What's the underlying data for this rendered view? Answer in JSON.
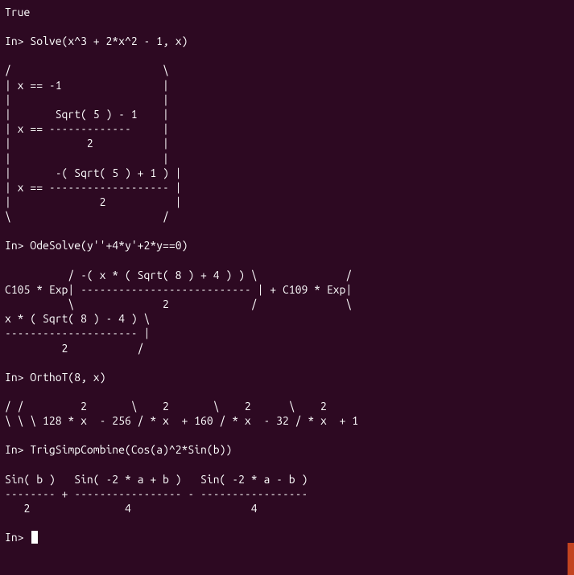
{
  "prev_result": "True",
  "cmd1": {
    "prompt": "In>",
    "input": "Solve(x^3 + 2*x^2 - 1, x)"
  },
  "out1": [
    "/                        \\",
    "| x == -1                |",
    "|                        |",
    "|       Sqrt( 5 ) - 1    |",
    "| x == -------------     |",
    "|            2           |",
    "|                        |",
    "|       -( Sqrt( 5 ) + 1 ) |",
    "| x == ------------------- |",
    "|              2           |",
    "\\                        /"
  ],
  "cmd2": {
    "prompt": "In>",
    "input": "OdeSolve(y''+4*y'+2*y==0)"
  },
  "out2": [
    "          / -( x * ( Sqrt( 8 ) + 4 ) ) \\              /",
    "C105 * Exp| --------------------------- | + C109 * Exp|",
    "          \\              2             /              \\",
    "",
    "x * ( Sqrt( 8 ) - 4 ) \\",
    "--------------------- |",
    "         2           /"
  ],
  "cmd3": {
    "prompt": "In>",
    "input": "OrthoT(8, x)"
  },
  "out3": [
    "/ /         2       \\    2       \\    2      \\    2",
    "\\ \\ \\ 128 * x  - 256 / * x  + 160 / * x  - 32 / * x  + 1"
  ],
  "cmd4": {
    "prompt": "In>",
    "input": "TrigSimpCombine(Cos(a)^2*Sin(b))"
  },
  "out4": [
    "Sin( b )   Sin( -2 * a + b )   Sin( -2 * a - b )",
    "-------- + ----------------- - -----------------",
    "   2               4                   4"
  ],
  "cmd5": {
    "prompt": "In>"
  }
}
